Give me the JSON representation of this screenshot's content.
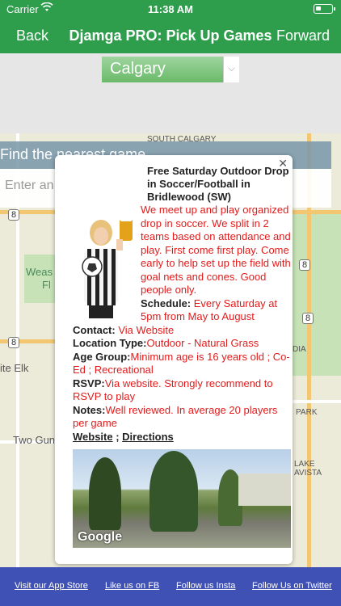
{
  "status_bar": {
    "carrier": "Carrier",
    "time": "11:38 AM"
  },
  "nav": {
    "back": "Back",
    "title": "Djamga PRO: Pick Up Games",
    "forward": "Forward"
  },
  "city_select": {
    "value": "Calgary"
  },
  "map_labels": {
    "area_top": "SOUTH CALGARY",
    "west": "Weas",
    "west2": "Fl",
    "elk": "ite Elk",
    "two_gun": "Two Gun",
    "park": "PARK",
    "lake": "LAKE",
    "lake2": "AVISTA",
    "dia": "DIA",
    "shield_8a": "8",
    "shield_8b": "8",
    "shield_8c": "8",
    "shield_8d": "8"
  },
  "finder": {
    "heading": "Find the nearest game",
    "placeholder": "Enter an a"
  },
  "popup": {
    "title": "Free Saturday Outdoor Drop in Soccer/Football in Bridlewood (SW)",
    "description": "We meet up and play organized drop in soccer. We split in 2 teams based on attendance and play. First come first play. Come early to help set up the field with goal nets and cones. Good people only.",
    "schedule_label": "Schedule:",
    "schedule_value": " Every Saturday at 5pm from May to August",
    "contact_label": "Contact:",
    "contact_value": " Via Website",
    "location_label": "Location Type:",
    "location_value": "Outdoor - Natural Grass",
    "age_label": "Age Group:",
    "age_value": "Minimum age is 16 years old ; Co-Ed ; Recreational",
    "rsvp_label": "RSVP:",
    "rsvp_value": "Via website. Strongly recommend to RSVP to play",
    "notes_label": "Notes:",
    "notes_value": "Well reviewed. In average 20 players per game",
    "website_link": "Website",
    "separator": " ; ",
    "directions_link": "Directions",
    "photo_brand": "Google"
  },
  "footer": {
    "app_store": "Visit our App Store",
    "fb": "Like us on FB",
    "insta": "Follow us Insta",
    "twitter": "Follow Us on Twitter"
  },
  "colors": {
    "nav_green": "#2e9e4c",
    "footer_blue": "#3f51b5",
    "accent_red": "#e31b1b"
  }
}
